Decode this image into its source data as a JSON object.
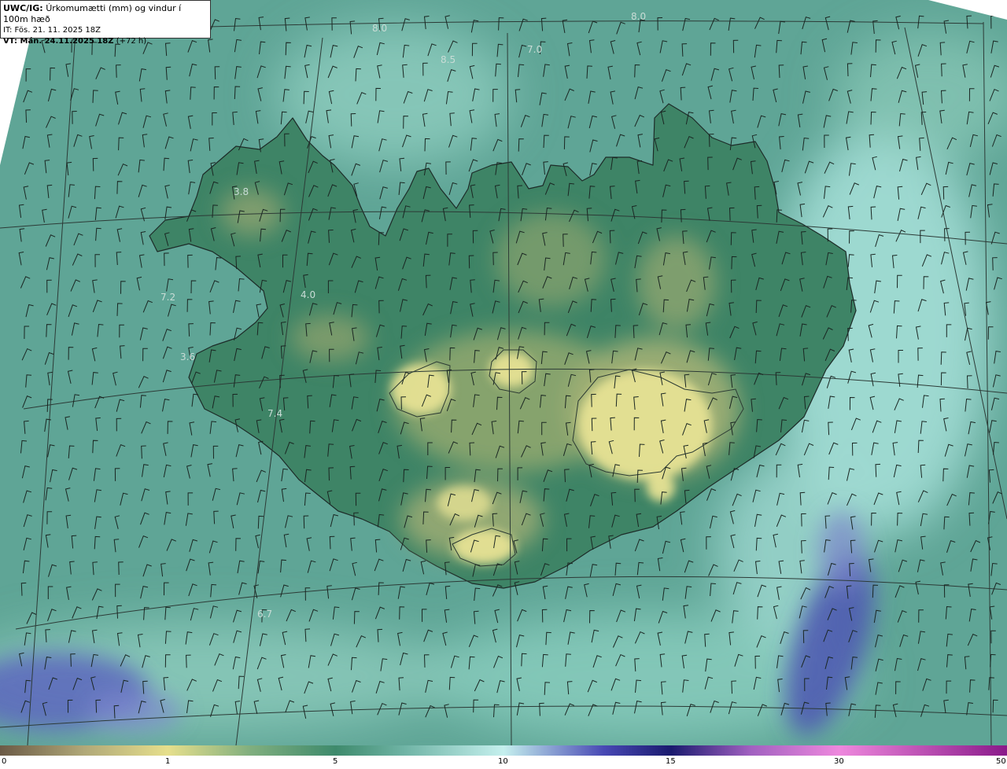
{
  "header": {
    "model_prefix": "UWC/IG:",
    "title": "Úrkomumætti (mm) og vindur í 100m hæð",
    "init_time": "IT: Fös. 21. 11. 2025 18Z",
    "valid_prefix": "VT: Mán. 24.11.2025 18Z",
    "valid_suffix": "(+72 h)"
  },
  "colorbar": {
    "ticks": [
      "0",
      "1",
      "5",
      "10",
      "15",
      "30",
      "50"
    ],
    "stops": [
      {
        "value": 0,
        "color": "#6b5a46"
      },
      {
        "value": 0.5,
        "color": "#b0a878"
      },
      {
        "value": 1,
        "color": "#e6df8c"
      },
      {
        "value": 3,
        "color": "#7fae7e"
      },
      {
        "value": 5,
        "color": "#3e8a6c"
      },
      {
        "value": 7,
        "color": "#6eb3a4"
      },
      {
        "value": 10,
        "color": "#c5f0ee"
      },
      {
        "value": 13,
        "color": "#4848b4"
      },
      {
        "value": 15,
        "color": "#1a1a6e"
      },
      {
        "value": 22,
        "color": "#a060c0"
      },
      {
        "value": 30,
        "color": "#ee88dd"
      },
      {
        "value": 50,
        "color": "#8a1a8a"
      }
    ]
  },
  "isovalues": [
    "8.0",
    "8.0",
    "7.0",
    "8.5",
    "3.8",
    "7.2",
    "4.0",
    "3.6",
    "7.4",
    "6.7"
  ],
  "colors": {
    "sea": "#5fa596",
    "sea_light": "#9ad6cc",
    "land_low": "#3f8566",
    "land_high": "#b7c27e",
    "glacier": "#e2e096",
    "high_precip": "#5a62b4"
  },
  "wind_barbs": "northerly wind barbs across the whole domain"
}
